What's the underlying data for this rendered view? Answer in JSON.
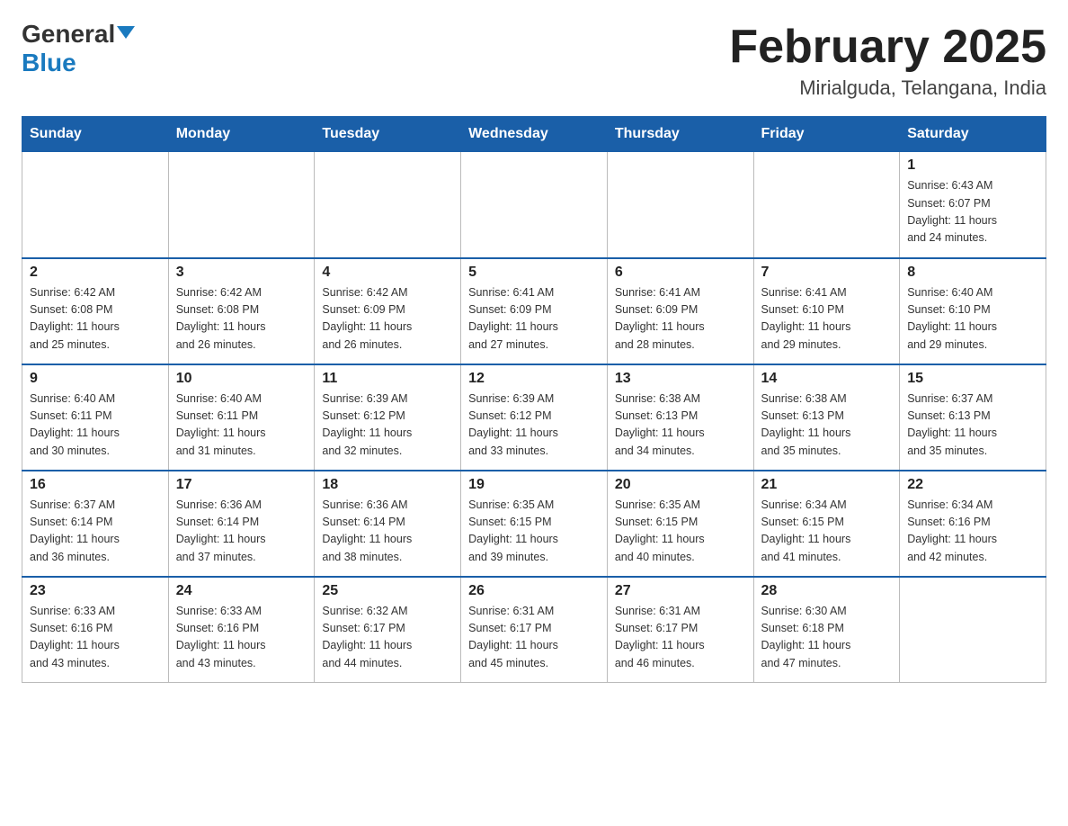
{
  "header": {
    "logo_line1": "General",
    "logo_line2": "Blue",
    "month_title": "February 2025",
    "location": "Mirialguda, Telangana, India"
  },
  "weekdays": [
    "Sunday",
    "Monday",
    "Tuesday",
    "Wednesday",
    "Thursday",
    "Friday",
    "Saturday"
  ],
  "weeks": [
    [
      {
        "day": "",
        "info": "",
        "empty": true
      },
      {
        "day": "",
        "info": "",
        "empty": true
      },
      {
        "day": "",
        "info": "",
        "empty": true
      },
      {
        "day": "",
        "info": "",
        "empty": true
      },
      {
        "day": "",
        "info": "",
        "empty": true
      },
      {
        "day": "",
        "info": "",
        "empty": true
      },
      {
        "day": "1",
        "info": "Sunrise: 6:43 AM\nSunset: 6:07 PM\nDaylight: 11 hours\nand 24 minutes."
      }
    ],
    [
      {
        "day": "2",
        "info": "Sunrise: 6:42 AM\nSunset: 6:08 PM\nDaylight: 11 hours\nand 25 minutes."
      },
      {
        "day": "3",
        "info": "Sunrise: 6:42 AM\nSunset: 6:08 PM\nDaylight: 11 hours\nand 26 minutes."
      },
      {
        "day": "4",
        "info": "Sunrise: 6:42 AM\nSunset: 6:09 PM\nDaylight: 11 hours\nand 26 minutes."
      },
      {
        "day": "5",
        "info": "Sunrise: 6:41 AM\nSunset: 6:09 PM\nDaylight: 11 hours\nand 27 minutes."
      },
      {
        "day": "6",
        "info": "Sunrise: 6:41 AM\nSunset: 6:09 PM\nDaylight: 11 hours\nand 28 minutes."
      },
      {
        "day": "7",
        "info": "Sunrise: 6:41 AM\nSunset: 6:10 PM\nDaylight: 11 hours\nand 29 minutes."
      },
      {
        "day": "8",
        "info": "Sunrise: 6:40 AM\nSunset: 6:10 PM\nDaylight: 11 hours\nand 29 minutes."
      }
    ],
    [
      {
        "day": "9",
        "info": "Sunrise: 6:40 AM\nSunset: 6:11 PM\nDaylight: 11 hours\nand 30 minutes."
      },
      {
        "day": "10",
        "info": "Sunrise: 6:40 AM\nSunset: 6:11 PM\nDaylight: 11 hours\nand 31 minutes."
      },
      {
        "day": "11",
        "info": "Sunrise: 6:39 AM\nSunset: 6:12 PM\nDaylight: 11 hours\nand 32 minutes."
      },
      {
        "day": "12",
        "info": "Sunrise: 6:39 AM\nSunset: 6:12 PM\nDaylight: 11 hours\nand 33 minutes."
      },
      {
        "day": "13",
        "info": "Sunrise: 6:38 AM\nSunset: 6:13 PM\nDaylight: 11 hours\nand 34 minutes."
      },
      {
        "day": "14",
        "info": "Sunrise: 6:38 AM\nSunset: 6:13 PM\nDaylight: 11 hours\nand 35 minutes."
      },
      {
        "day": "15",
        "info": "Sunrise: 6:37 AM\nSunset: 6:13 PM\nDaylight: 11 hours\nand 35 minutes."
      }
    ],
    [
      {
        "day": "16",
        "info": "Sunrise: 6:37 AM\nSunset: 6:14 PM\nDaylight: 11 hours\nand 36 minutes."
      },
      {
        "day": "17",
        "info": "Sunrise: 6:36 AM\nSunset: 6:14 PM\nDaylight: 11 hours\nand 37 minutes."
      },
      {
        "day": "18",
        "info": "Sunrise: 6:36 AM\nSunset: 6:14 PM\nDaylight: 11 hours\nand 38 minutes."
      },
      {
        "day": "19",
        "info": "Sunrise: 6:35 AM\nSunset: 6:15 PM\nDaylight: 11 hours\nand 39 minutes."
      },
      {
        "day": "20",
        "info": "Sunrise: 6:35 AM\nSunset: 6:15 PM\nDaylight: 11 hours\nand 40 minutes."
      },
      {
        "day": "21",
        "info": "Sunrise: 6:34 AM\nSunset: 6:15 PM\nDaylight: 11 hours\nand 41 minutes."
      },
      {
        "day": "22",
        "info": "Sunrise: 6:34 AM\nSunset: 6:16 PM\nDaylight: 11 hours\nand 42 minutes."
      }
    ],
    [
      {
        "day": "23",
        "info": "Sunrise: 6:33 AM\nSunset: 6:16 PM\nDaylight: 11 hours\nand 43 minutes."
      },
      {
        "day": "24",
        "info": "Sunrise: 6:33 AM\nSunset: 6:16 PM\nDaylight: 11 hours\nand 43 minutes."
      },
      {
        "day": "25",
        "info": "Sunrise: 6:32 AM\nSunset: 6:17 PM\nDaylight: 11 hours\nand 44 minutes."
      },
      {
        "day": "26",
        "info": "Sunrise: 6:31 AM\nSunset: 6:17 PM\nDaylight: 11 hours\nand 45 minutes."
      },
      {
        "day": "27",
        "info": "Sunrise: 6:31 AM\nSunset: 6:17 PM\nDaylight: 11 hours\nand 46 minutes."
      },
      {
        "day": "28",
        "info": "Sunrise: 6:30 AM\nSunset: 6:18 PM\nDaylight: 11 hours\nand 47 minutes."
      },
      {
        "day": "",
        "info": "",
        "empty": true
      }
    ]
  ]
}
